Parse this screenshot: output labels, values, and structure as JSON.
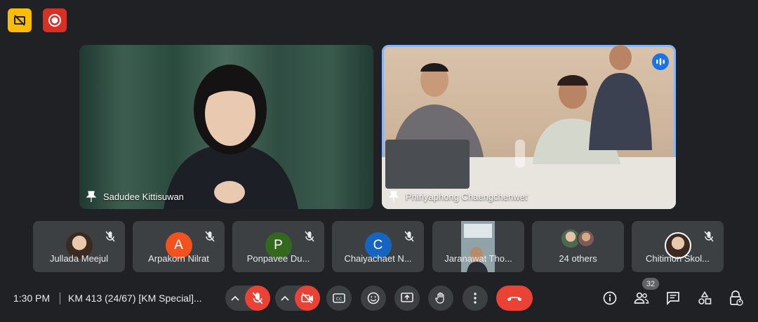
{
  "main_tiles": [
    {
      "name": "Sadudee Kittisuwan"
    },
    {
      "name": "Phiriyaphong Chaengchenwet"
    }
  ],
  "participants": [
    {
      "name": "Jullada Meejul",
      "avatar": "photo"
    },
    {
      "name": "Arpakorn Nilrat",
      "initial": "A",
      "color": "#f4511e"
    },
    {
      "name": "Ponpavee Du...",
      "initial": "P",
      "color": "#33691e"
    },
    {
      "name": "Chaiyachaet N...",
      "initial": "C",
      "color": "#1565c0"
    },
    {
      "name": "Jaranawat Tho...",
      "avatar": "video"
    },
    {
      "name": "24 others",
      "avatar": "group"
    },
    {
      "name": "Chitimon Skol...",
      "avatar": "photo"
    }
  ],
  "bottom_bar": {
    "time": "1:30 PM",
    "meeting_title": "KM 413 (24/67) [KM Special]...",
    "people_count": "32"
  },
  "colors": {
    "background": "#202124",
    "tile": "#3c4043",
    "danger": "#ea4335",
    "active_speaker": "#8ab4f8"
  }
}
